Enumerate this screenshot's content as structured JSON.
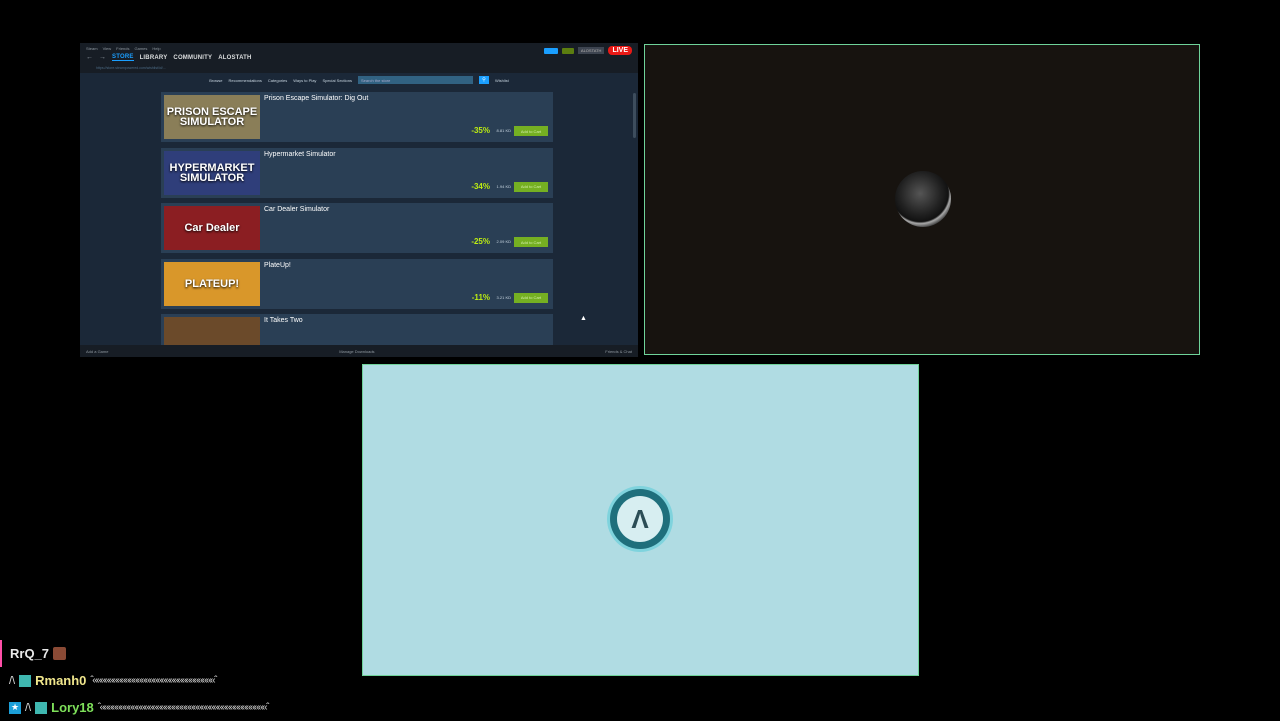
{
  "steam": {
    "menu": [
      "Steam",
      "View",
      "Friends",
      "Games",
      "Help"
    ],
    "nav": [
      "STORE",
      "LIBRARY",
      "COMMUNITY",
      "ALOSTATH"
    ],
    "url": "https://store.steampowered.com/wishlist/id/...",
    "account": "ALOSTATH",
    "live": "LIVE",
    "subnav": [
      "Browse",
      "Recommendations",
      "Categories",
      "Ways to Play",
      "Special Sections"
    ],
    "search_placeholder": "Search the store",
    "wishlist": "Wishlist",
    "games": [
      {
        "title": "Prison Escape Simulator: Dig Out",
        "thumb": "PRISON ESCAPE SIMULATOR",
        "thumb_color": "#8a7e58",
        "discount": "-35%",
        "price": "8.81 KD",
        "cart": "Add to Cart"
      },
      {
        "title": "Hypermarket Simulator",
        "thumb": "HYPERMARKET SIMULATOR",
        "thumb_color": "#2f3e7a",
        "discount": "-34%",
        "price": "1.94 KD",
        "cart": "Add to Cart"
      },
      {
        "title": "Car Dealer Simulator",
        "thumb": "Car Dealer",
        "thumb_color": "#8b1e22",
        "discount": "-25%",
        "price": "2.09 KD",
        "cart": "Add to Cart"
      },
      {
        "title": "PlateUp!",
        "thumb": "PLATEUP!",
        "thumb_color": "#d9972a",
        "discount": "-11%",
        "price": "3.21 KD",
        "cart": "Add to Cart"
      },
      {
        "title": "It Takes Two",
        "thumb": "",
        "thumb_color": "#6b4a2a",
        "discount": "",
        "price": "",
        "cart": ""
      }
    ],
    "bottom_left": "Add a Game",
    "bottom_mid": "Manage Downloads",
    "bottom_right": "Friends & Chat"
  },
  "chat": [
    {
      "user": "RrQ_7",
      "color": "#e8e8e8",
      "message": ""
    },
    {
      "user": "Rmanh0",
      "color": "#f0e68c",
      "message": "ˆ««««««««««««««««««««««««««««««ˆ"
    },
    {
      "user": "Lory18",
      "color": "#7ee05a",
      "message": "ˆ«««««««««««««««««««««««««««««««««««««««««ˆ"
    }
  ]
}
